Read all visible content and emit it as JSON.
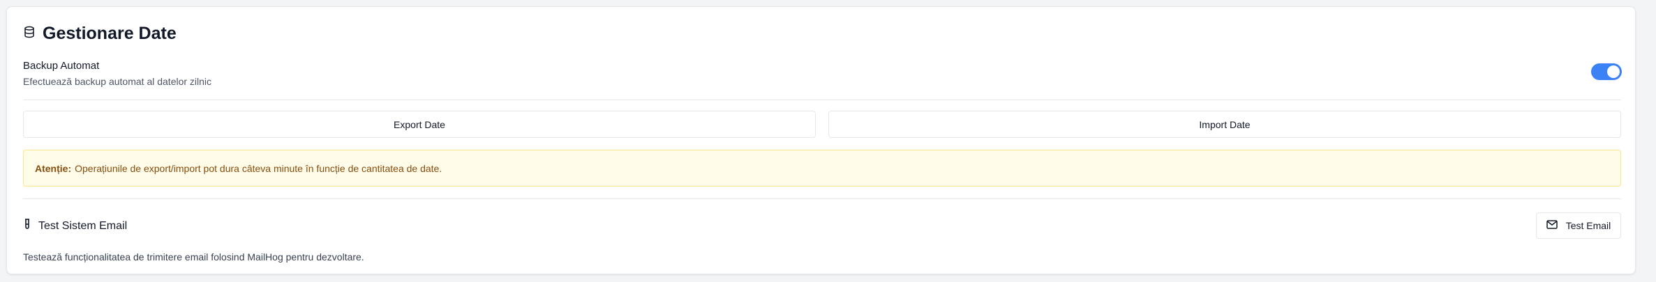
{
  "data_management": {
    "title": "Gestionare Date",
    "title_icon": "database-icon"
  },
  "backup": {
    "label": "Backup Automat",
    "description": "Efectuează backup automat al datelor zilnic",
    "enabled": true
  },
  "actions": {
    "export_label": "Export Date",
    "import_label": "Import Date"
  },
  "warning": {
    "prefix": "Atenție:",
    "message": "Operațiunile de export/import pot dura câteva minute în funcție de cantitatea de date."
  },
  "email_test": {
    "title": "Test Sistem Email",
    "title_icon": "test-tube-icon",
    "button_label": "Test Email",
    "button_icon": "mail-icon",
    "description": "Testează funcționalitatea de trimitere email folosind MailHog pentru dezvoltare."
  },
  "colors": {
    "accent": "#3b82f6",
    "warning_bg": "#fefce8",
    "warning_text": "#854d0e"
  }
}
